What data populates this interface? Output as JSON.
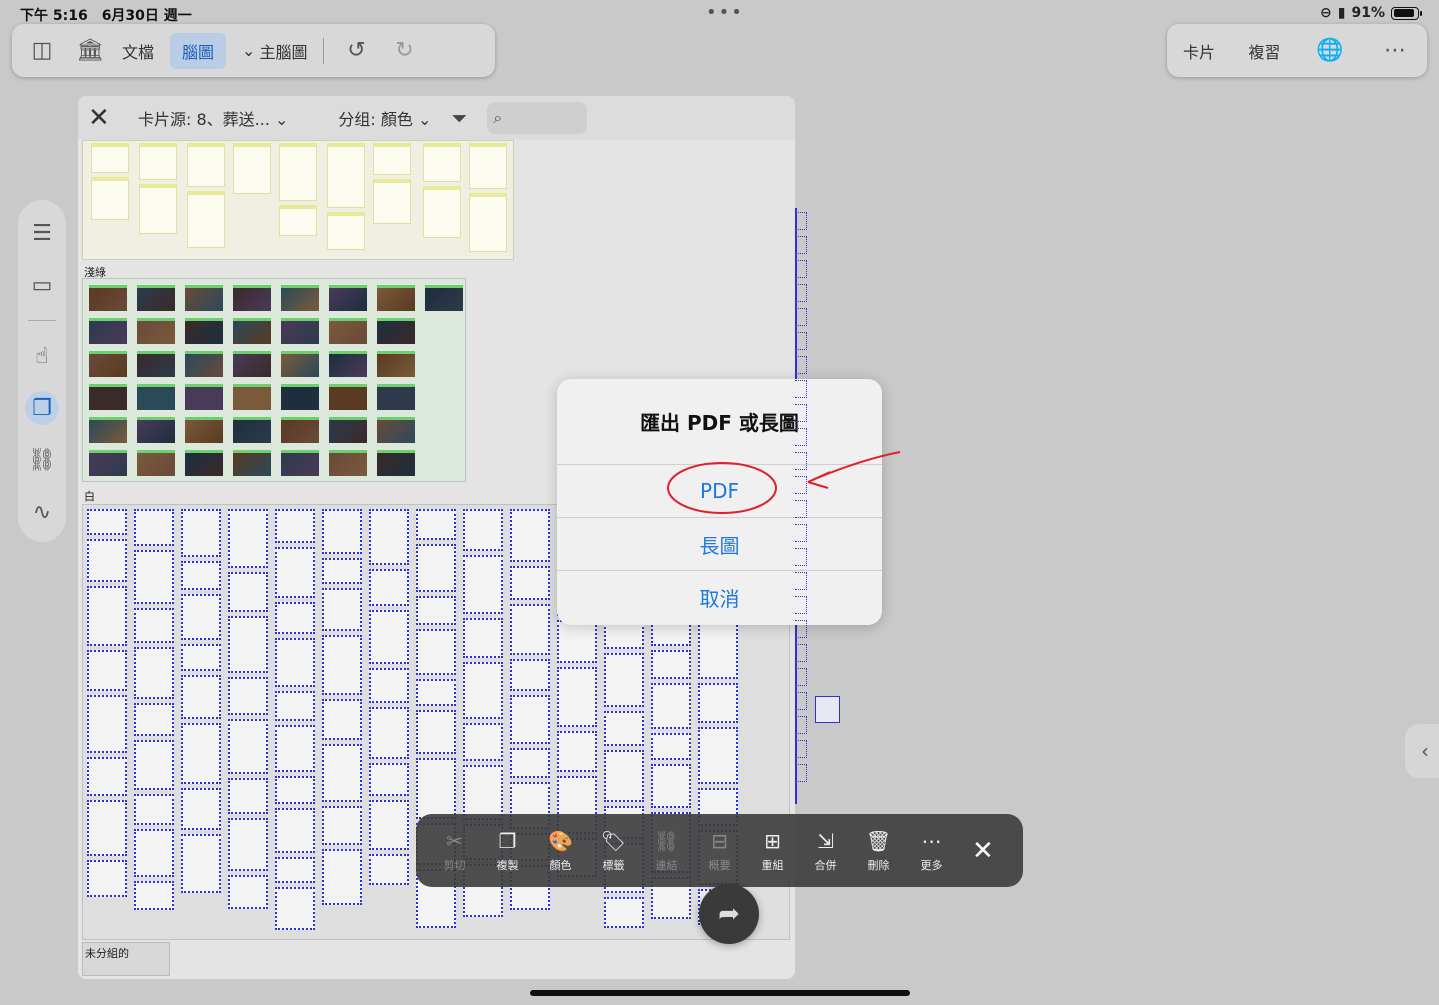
{
  "status_bar": {
    "time": "下午 5:16　6月30日 週一",
    "battery": "91%",
    "battery_level": 0.91
  },
  "top_toolbar": {
    "doc_label": "文檔",
    "mindmap_label": "腦圖",
    "main_mindmap_label": "主腦圖",
    "card_label": "卡片",
    "review_label": "複習"
  },
  "panel": {
    "card_source_label": "卡片源: 8、葬送...",
    "group_label": "分组: 顏色",
    "groups": {
      "light_green": "淺綠",
      "white": "白",
      "ungrouped": "未分組的"
    }
  },
  "dialog": {
    "title": "匯出 PDF 或長圖",
    "pdf": "PDF",
    "long_image": "長圖",
    "cancel": "取消"
  },
  "action_bar": {
    "items": [
      {
        "label": "剪切",
        "icon": "scissors-icon"
      },
      {
        "label": "複製",
        "icon": "copy-icon"
      },
      {
        "label": "顏色",
        "icon": "palette-icon"
      },
      {
        "label": "標籤",
        "icon": "tag-icon"
      },
      {
        "label": "連結",
        "icon": "link-icon"
      },
      {
        "label": "概要",
        "icon": "summary-icon"
      },
      {
        "label": "重組",
        "icon": "reorganize-icon"
      },
      {
        "label": "合併",
        "icon": "merge-icon"
      },
      {
        "label": "刪除",
        "icon": "trash-icon"
      },
      {
        "label": "更多",
        "icon": "more-icon"
      }
    ]
  },
  "colors": {
    "accent": "#1f77e0",
    "card_border": "#2b31d6",
    "annotation_red": "#e0202a"
  }
}
